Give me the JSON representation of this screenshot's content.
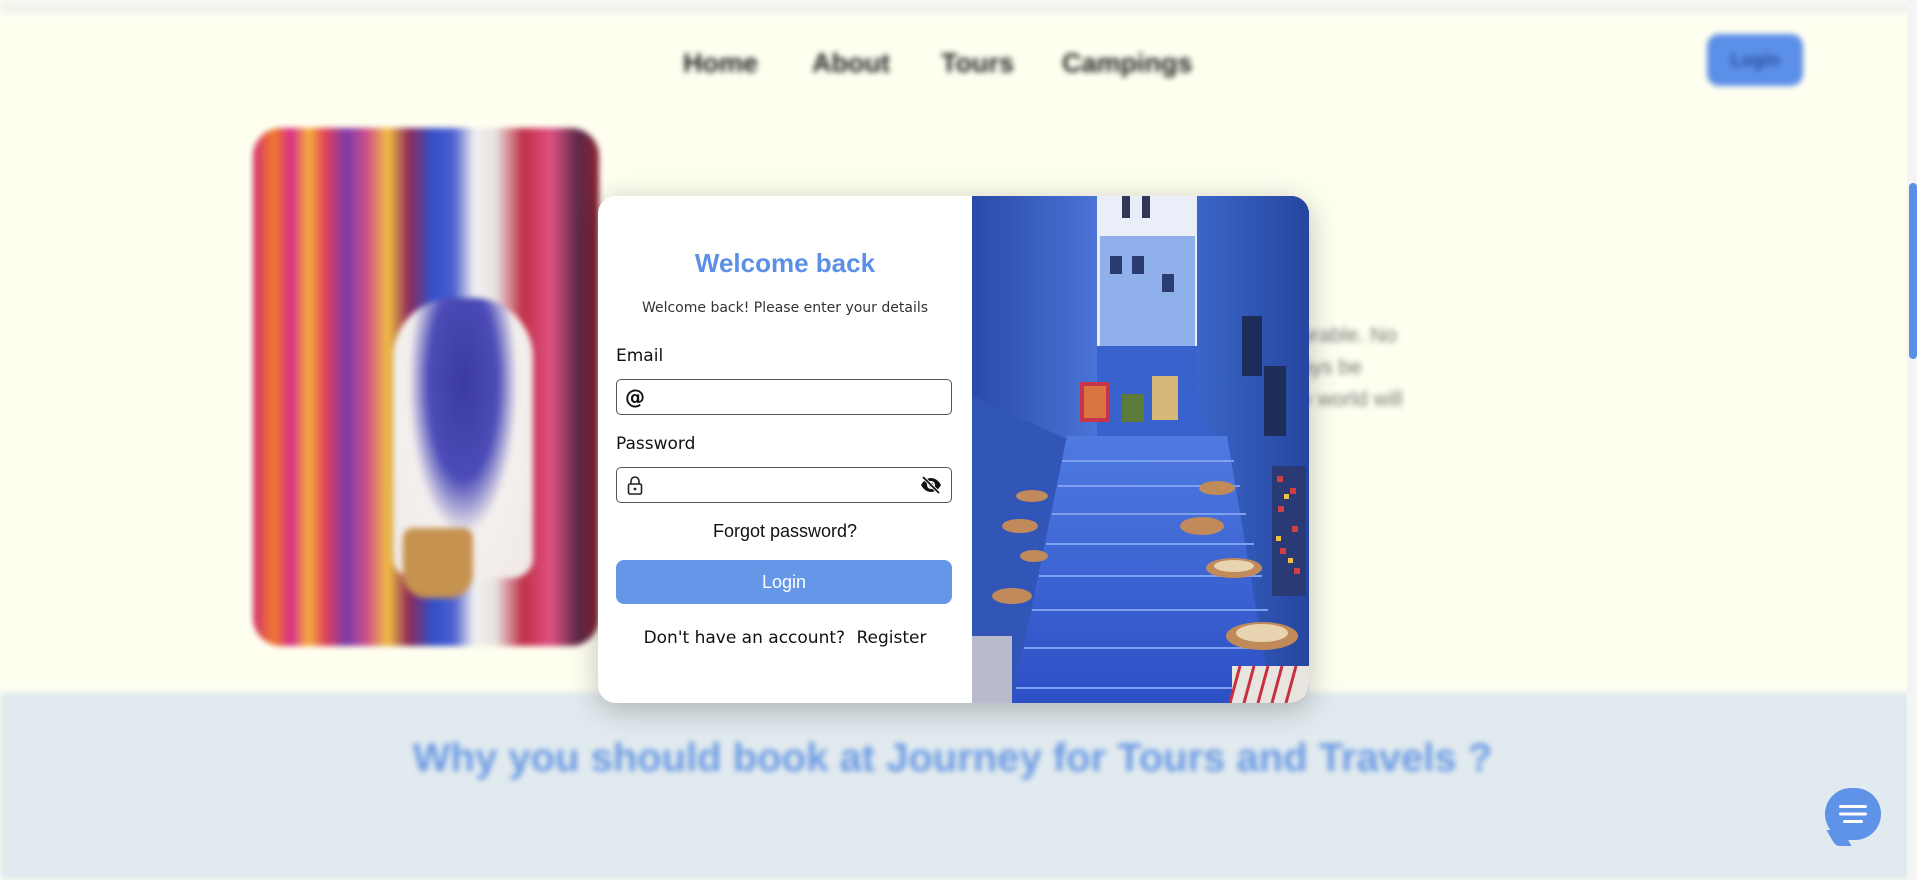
{
  "nav": {
    "links": [
      "Home",
      "About",
      "Tours",
      "Campings"
    ],
    "login_label": "Login"
  },
  "hero": {
    "text_lines": [
      "orable. No",
      "ays be",
      "e world will"
    ]
  },
  "section": {
    "title": "Why you should book at Journey for Tours and Travels ?"
  },
  "modal": {
    "title": "Welcome back",
    "subtitle": "Welcome back! Please enter your details",
    "email_label": "Email",
    "email_value": "",
    "password_label": "Password",
    "password_value": "",
    "forgot_label": "Forgot password?",
    "login_label": "Login",
    "no_account_text": "Don't have an account?",
    "register_label": "Register"
  },
  "colors": {
    "accent": "#5b8fe8",
    "page_bg": "#fffff0",
    "band_bg": "#e1eaee"
  },
  "icons": {
    "email_prefix": "at-icon",
    "password_prefix": "lock-icon",
    "password_toggle": "eye-off-icon",
    "chat": "chat-icon"
  }
}
